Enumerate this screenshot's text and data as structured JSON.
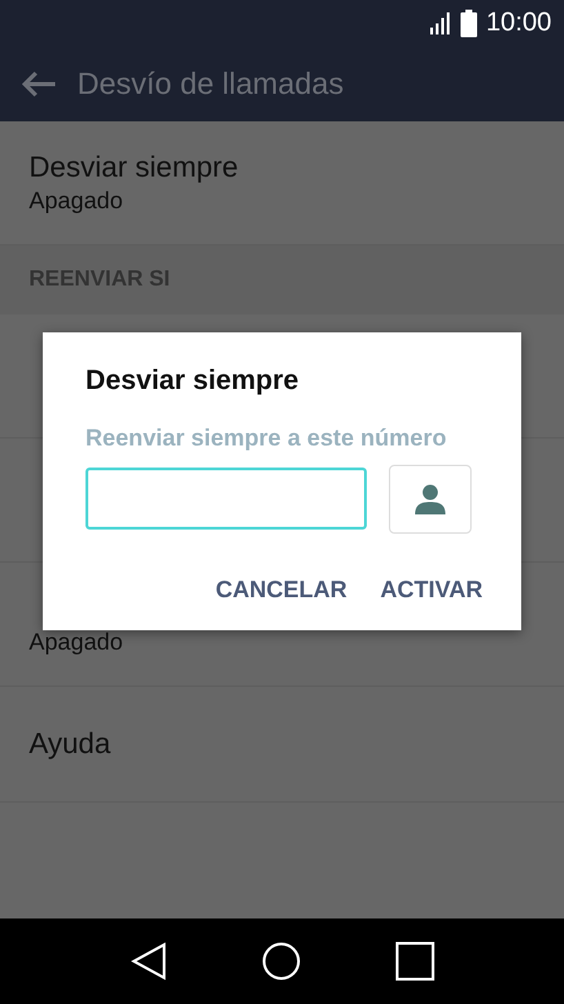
{
  "status_bar": {
    "time": "10:00"
  },
  "app_bar": {
    "title": "Desvío de llamadas"
  },
  "list": [
    {
      "kind": "item",
      "title": "Desviar siempre",
      "subtitle": "Apagado"
    },
    {
      "kind": "header",
      "title": "REENVIAR SI"
    },
    {
      "kind": "item"
    },
    {
      "kind": "item"
    },
    {
      "kind": "item",
      "subtitle": "Apagado"
    },
    {
      "kind": "item",
      "title": "Ayuda"
    }
  ],
  "dialog": {
    "title": "Desviar siempre",
    "label": "Reenviar siempre a este número",
    "buttons": [
      "CANCELAR",
      "ACTIVAR"
    ]
  }
}
